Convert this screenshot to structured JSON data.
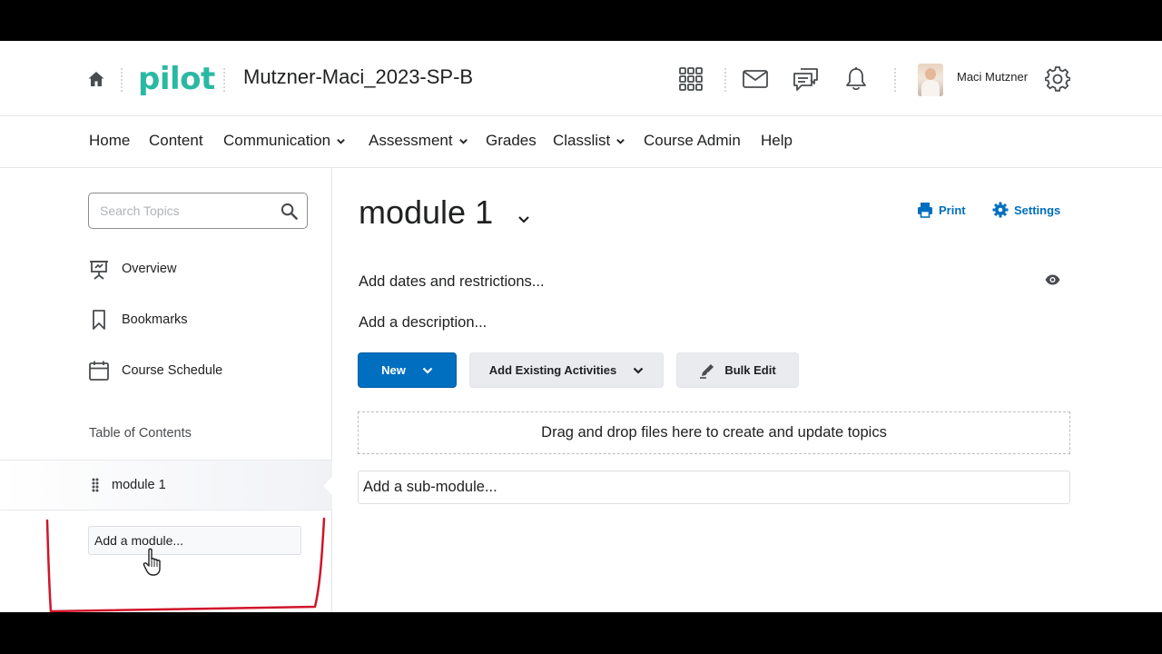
{
  "header": {
    "home_icon": "home-icon",
    "logo": "pilot",
    "course_title": "Mutzner-Maci_2023-SP-B",
    "icons": [
      "waffle-grid-icon",
      "mail-icon",
      "chat-icon",
      "bell-icon"
    ],
    "user_name": "Maci Mutzner",
    "settings_icon": "gear-icon",
    "brand_color": "#2bb8a3"
  },
  "nav": {
    "items": [
      {
        "label": "Home",
        "dropdown": false
      },
      {
        "label": "Content",
        "dropdown": false
      },
      {
        "label": "Communication",
        "dropdown": true
      },
      {
        "label": "Assessment",
        "dropdown": true
      },
      {
        "label": "Grades",
        "dropdown": false
      },
      {
        "label": "Classlist",
        "dropdown": true
      },
      {
        "label": "Course Admin",
        "dropdown": false
      },
      {
        "label": "Help",
        "dropdown": false
      }
    ]
  },
  "sidebar": {
    "search_placeholder": "Search Topics",
    "links": [
      {
        "label": "Overview",
        "icon": "presentation-icon"
      },
      {
        "label": "Bookmarks",
        "icon": "bookmark-icon"
      },
      {
        "label": "Course Schedule",
        "icon": "calendar-icon"
      }
    ],
    "toc_label": "Table of Contents",
    "modules": [
      {
        "label": "module 1",
        "selected": true
      }
    ],
    "add_module": "Add a module..."
  },
  "main": {
    "title": "module 1",
    "print_label": "Print",
    "settings_label": "Settings",
    "add_dates": "Add dates and restrictions...",
    "add_description": "Add a description...",
    "new_button": "New",
    "add_existing_button": "Add Existing Activities",
    "bulk_edit_button": "Bulk Edit",
    "dropzone": "Drag and drop files here to create and update topics",
    "add_submodule": "Add a sub-module...",
    "accent_color": "#006fbf"
  }
}
